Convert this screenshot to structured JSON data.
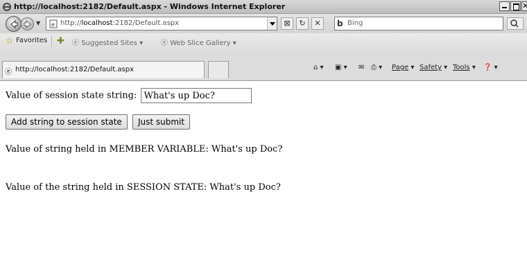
{
  "window": {
    "title": "http://localhost:2182/Default.aspx - Windows Internet Explorer"
  },
  "navbar": {
    "url_prefix": "http://",
    "url_host": "localhost",
    "url_rest": ":2182/Default.aspx",
    "search_placeholder": "Bing"
  },
  "favorites": {
    "favorites_label": "Favorites",
    "suggested_label": "Suggested Sites ▾",
    "webslice_label": "Web Slice Gallery ▾"
  },
  "tab": {
    "title": "http://localhost:2182/Default.aspx"
  },
  "commandbar": {
    "page_label": "Page",
    "safety_label": "Safety",
    "tools_label": "Tools"
  },
  "page": {
    "session_label": "Value of session state string:",
    "session_value": "What's up Doc?",
    "add_button": "Add string to session state",
    "submit_button": "Just submit",
    "member_line": "Value of string held in MEMBER VARIABLE:  What's up Doc?",
    "session_line": "Value of the string held in SESSION STATE: What's up Doc?"
  }
}
